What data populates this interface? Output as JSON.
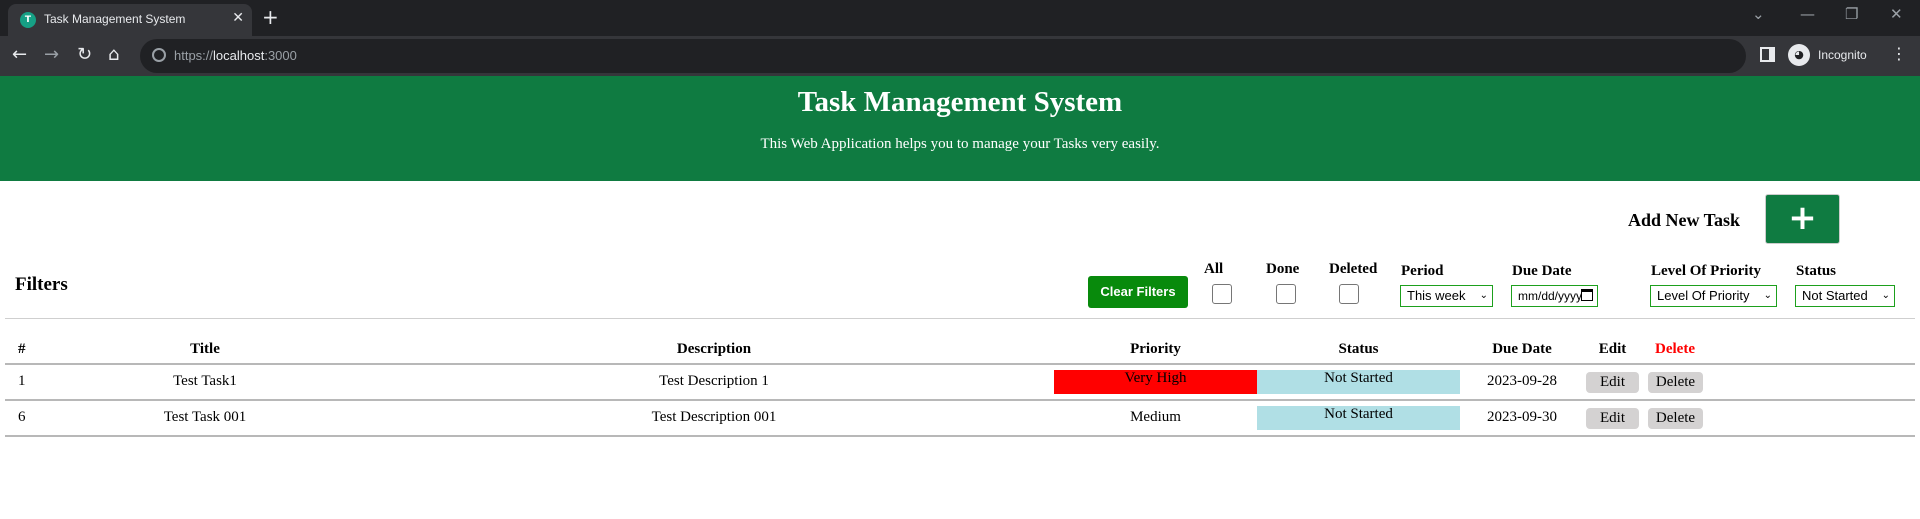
{
  "browser": {
    "tab_title": "Task Management System",
    "favicon_glyph": "T",
    "url_scheme": "https://",
    "url_host": "localhost",
    "url_port": ":3000",
    "profile_label": "Incognito"
  },
  "header": {
    "title": "Task Management System",
    "subtitle": "This Web Application helps you to manage your Tasks very easily."
  },
  "add_task": {
    "label": "Add New Task",
    "button_glyph": "+"
  },
  "filters": {
    "title": "Filters",
    "clear_label": "Clear Filters",
    "all_label": "All",
    "done_label": "Done",
    "deleted_label": "Deleted",
    "period_label": "Period",
    "period_value": "This week",
    "due_date_label": "Due Date",
    "due_date_placeholder": "mm/dd/yyyy",
    "priority_label": "Level Of Priority",
    "priority_value": "Level Of Priority",
    "status_label": "Status",
    "status_value": "Not Started"
  },
  "table": {
    "columns": {
      "num": "#",
      "title": "Title",
      "description": "Description",
      "priority": "Priority",
      "status": "Status",
      "due_date": "Due Date",
      "edit": "Edit",
      "delete": "Delete"
    },
    "rows": [
      {
        "num": "1",
        "title": "Test Task1",
        "description": "Test Description 1",
        "priority": "Very High",
        "status": "Not Started",
        "due_date": "2023-09-28",
        "edit": "Edit",
        "delete": "Delete"
      },
      {
        "num": "6",
        "title": "Test Task 001",
        "description": "Test Description 001",
        "priority": "Medium",
        "status": "Not Started",
        "due_date": "2023-09-30",
        "edit": "Edit",
        "delete": "Delete"
      }
    ]
  },
  "colors": {
    "header_bg": "#0f7b41",
    "clear_btn_bg": "#088a0c",
    "very_high_bg": "#ff0000",
    "not_started_bg": "#b0dfe5",
    "delete_header": "#ff0000"
  }
}
